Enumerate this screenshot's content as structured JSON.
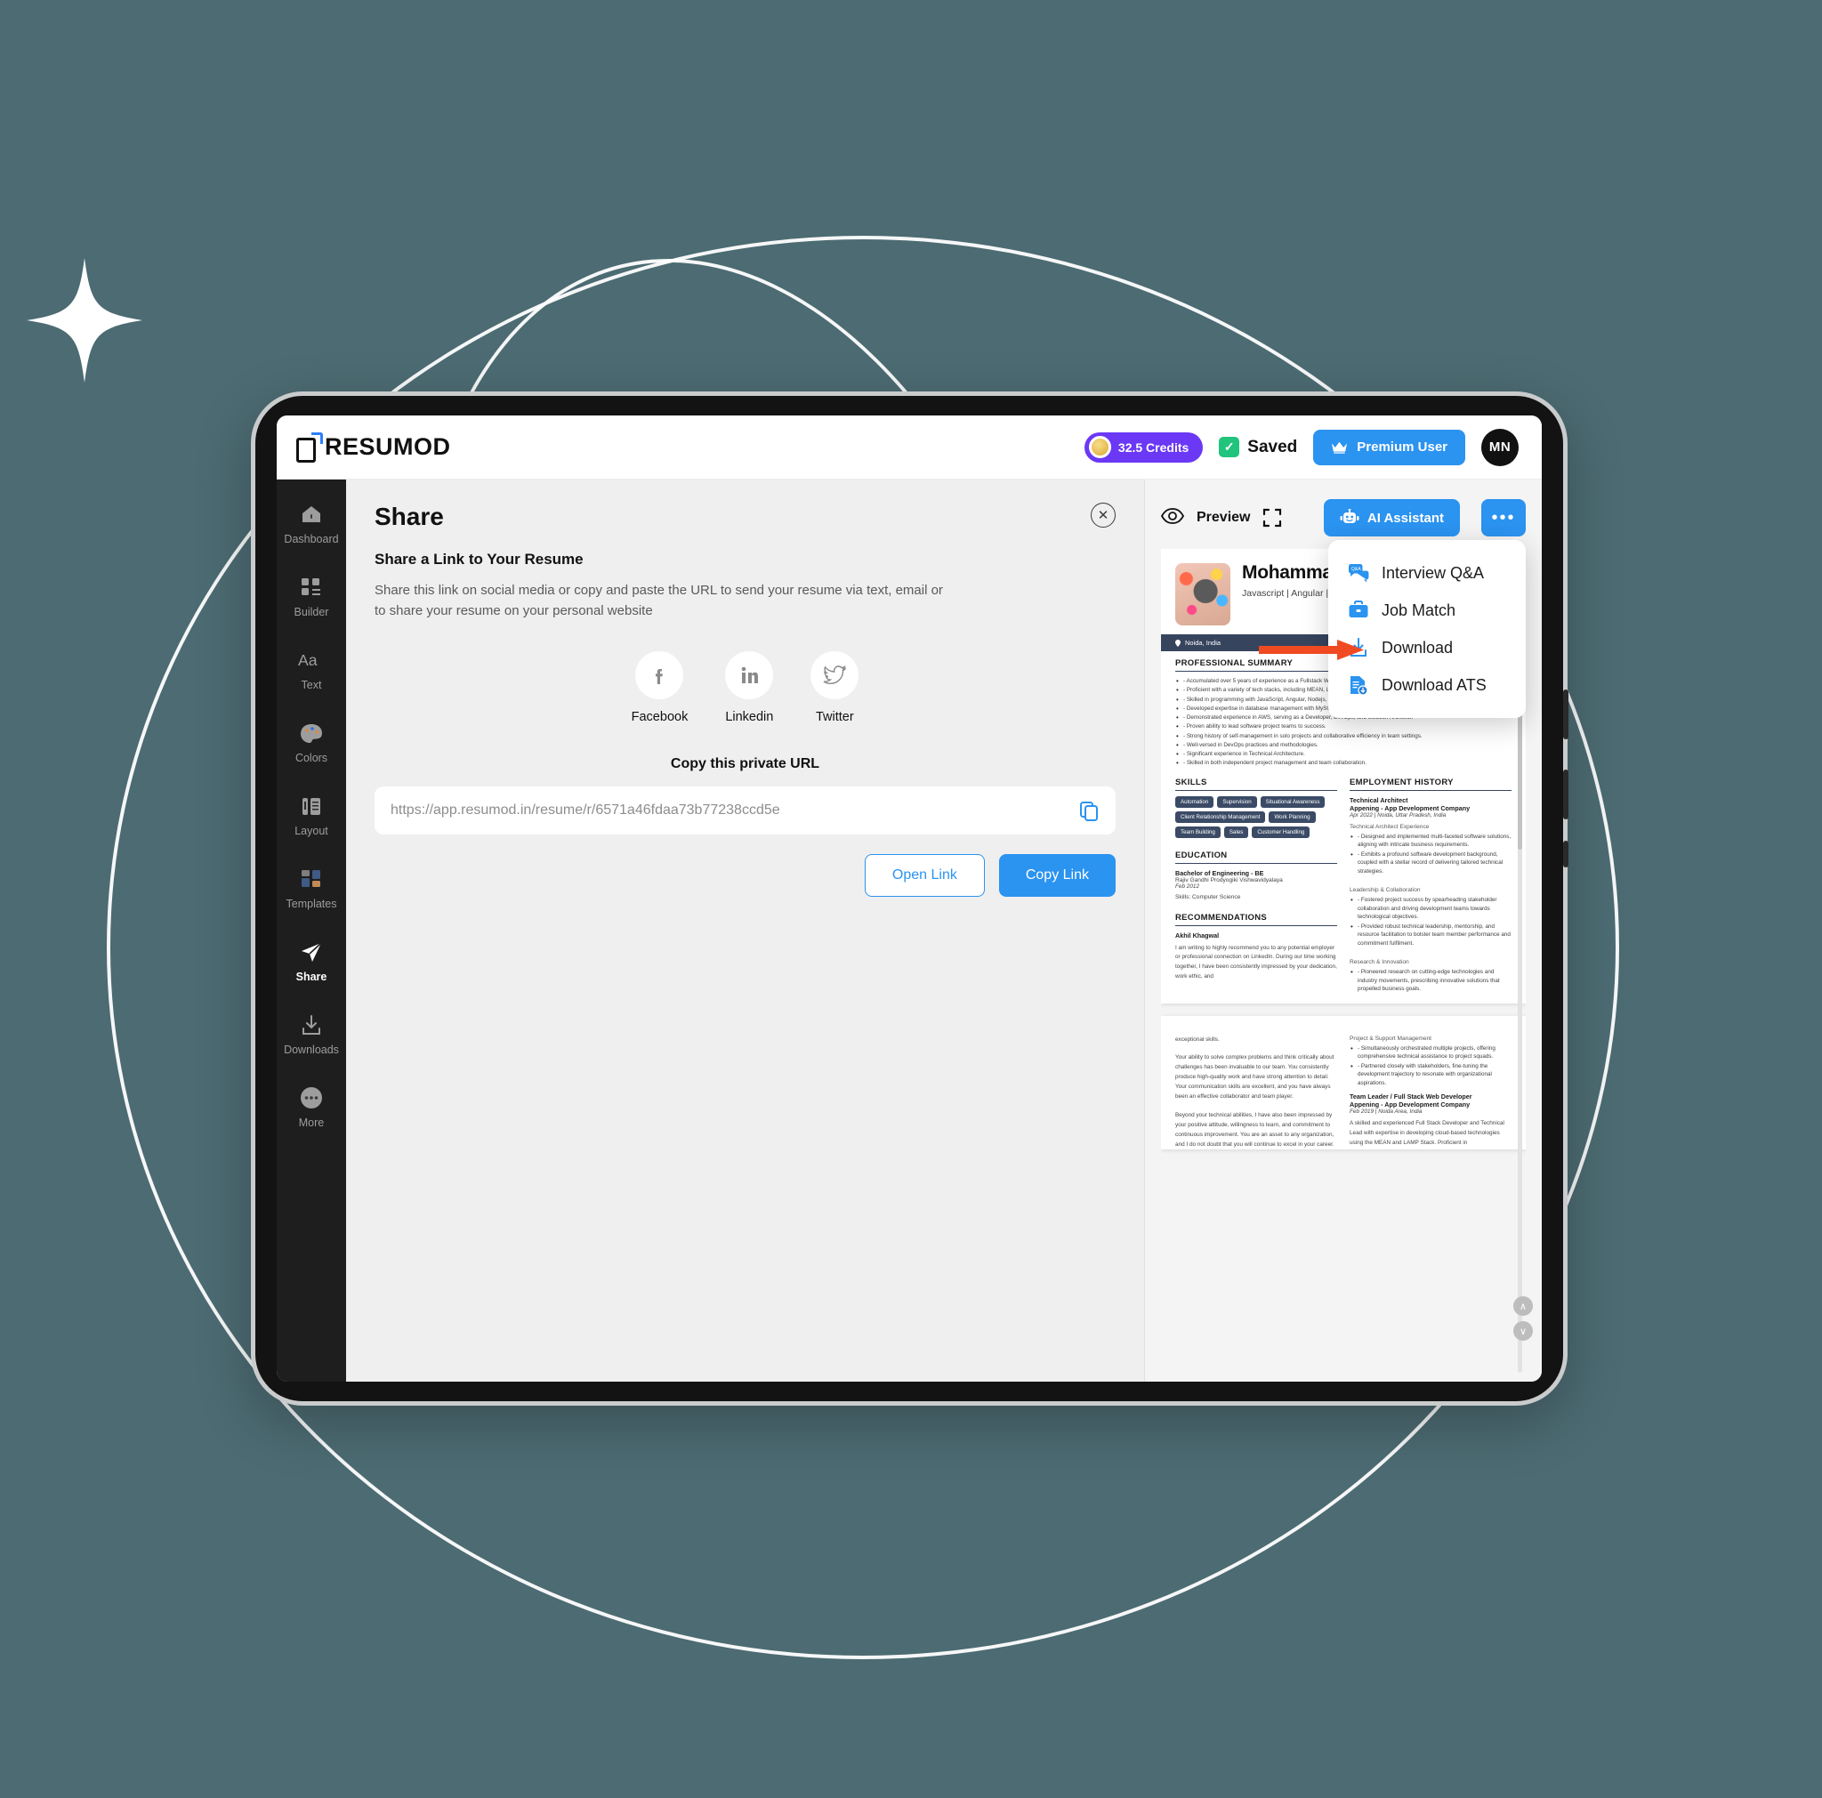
{
  "app": {
    "logo_text": "RESUMOD"
  },
  "topbar": {
    "credits": "32.5 Credits",
    "saved_label": "Saved",
    "saved_check": "✓",
    "premium_label": "Premium User",
    "avatar_initials": "MN"
  },
  "sidebar": {
    "items": [
      {
        "label": "Dashboard",
        "icon": "home-icon",
        "active": false
      },
      {
        "label": "Builder",
        "icon": "builder-icon",
        "active": false
      },
      {
        "label": "Text",
        "icon": "text-icon",
        "active": false
      },
      {
        "label": "Colors",
        "icon": "palette-icon",
        "active": false
      },
      {
        "label": "Layout",
        "icon": "layout-icon",
        "active": false
      },
      {
        "label": "Templates",
        "icon": "templates-icon",
        "active": false
      },
      {
        "label": "Share",
        "icon": "share-icon",
        "active": true
      },
      {
        "label": "Downloads",
        "icon": "download-icon",
        "active": false
      },
      {
        "label": "More",
        "icon": "more-icon",
        "active": false
      }
    ]
  },
  "share": {
    "title": "Share",
    "close_label": "✕",
    "subtitle": "Share a Link to Your Resume",
    "description": "Share this link on social media or copy and paste the URL to send your resume via text, email or to share your resume on your personal website",
    "socials": [
      {
        "label": "Facebook",
        "icon": "facebook-icon"
      },
      {
        "label": "Linkedin",
        "icon": "linkedin-icon"
      },
      {
        "label": "Twitter",
        "icon": "twitter-icon"
      }
    ],
    "copy_heading": "Copy this private URL",
    "url_value": "https://app.resumod.in/resume/r/6571a46fdaa73b77238ccd5e",
    "open_link_label": "Open Link",
    "copy_link_label": "Copy Link"
  },
  "preview": {
    "label": "Preview",
    "ai_assistant_label": "AI Assistant",
    "more_label": "•••",
    "menu": [
      {
        "label": "Interview Q&A",
        "icon": "chat-qa-icon"
      },
      {
        "label": "Job Match",
        "icon": "briefcase-icon"
      },
      {
        "label": "Download",
        "icon": "download-arrow-icon"
      },
      {
        "label": "Download ATS",
        "icon": "document-download-icon"
      }
    ],
    "scroll_up": "∧",
    "scroll_down": "∨"
  },
  "resume": {
    "name": "Mohammad Rizwan",
    "tagline": "Javascript | Angular | MySQL | AWS",
    "location": "Noida, India",
    "summary_title": "PROFESSIONAL SUMMARY",
    "summary_bullets": [
      "- Accumulated over 5 years of experience as a Fullstack Web Developer.",
      "- Proficient with a variety of tech stacks, including MEAN, LAMP",
      "- Skilled in programming with JavaScript, Angular, Nodejs, React",
      "- Developed expertise in database management with MySQL and MongoDB.",
      "- Demonstrated experience in AWS, serving as a Developer, DevOps, and Solution Architect.",
      "- Proven ability to lead software project teams to success.",
      "- Strong history of self-management in solo projects and collaborative efficiency in team settings.",
      "- Well-versed in DevOps practices and methodologies.",
      "- Significant experience in Technical Architecture.",
      "- Skilled in both independent project management and team collaboration."
    ],
    "skills_title": "SKILLS",
    "skills": [
      "Automation",
      "Supervision",
      "Situational Awareness",
      "Client Relationship Management",
      "Work Planning",
      "Team Building",
      "Sales",
      "Customer Handling"
    ],
    "education_title": "EDUCATION",
    "education": {
      "degree": "Bachelor of Engineering - BE",
      "school": "Rajiv Gandhi Prodyogiki Vishwavidyalaya",
      "date": "Feb 2012",
      "extra": "Skills: Computer Science"
    },
    "recommendations_title": "RECOMMENDATIONS",
    "recommendation": {
      "author": "Akhil Khagwal",
      "text": "I am writing to highly recommend you to any potential employer or professional connection on LinkedIn. During our time working together, I have been consistently impressed by your dedication, work ethic, and"
    },
    "employment_title": "EMPLOYMENT HISTORY",
    "jobs": [
      {
        "role": "Technical Architect",
        "company": "Appening - App Development Company",
        "meta": "Apr 2022 | Noida, Uttar Pradesh, India",
        "groups": [
          {
            "heading": "Technical Architect Experience",
            "bullets": [
              "- Designed and implemented multi-faceted software solutions, aligning with intricate business requirements.",
              "- Exhibits a profound software development background, coupled with a stellar record of delivering tailored technical strategies."
            ]
          },
          {
            "heading": "Leadership & Collaboration",
            "bullets": [
              "- Fostered project success by spearheading stakeholder collaboration and driving development teams towards technological objectives.",
              "- Provided robust technical leadership, mentorship, and resource facilitation to bolster team member performance and commitment fulfilment."
            ]
          },
          {
            "heading": "Research & Innovation",
            "bullets": [
              "- Pioneered research on cutting-edge technologies and industry movements, prescribing innovative solutions that propelled business goals."
            ]
          }
        ]
      }
    ],
    "page2": {
      "left_first_line": "exceptional skills.",
      "left_paragraphs": [
        "Your ability to solve complex problems and think critically about challenges has been invaluable to our team. You consistently produce high-quality work and have strong attention to detail. Your communication skills are excellent, and you have always been an effective collaborator and team player.",
        "Beyond your technical abilities, I have also been impressed by your positive attitude, willingness to learn, and commitment to continuous improvement. You are an asset to any organization, and I do not doubt that you will continue to excel in your career."
      ],
      "right_group_heading": "Project & Support Management",
      "right_bullets": [
        "- Simultaneously orchestrated multiple projects, offering comprehensive technical assistance to project squads.",
        "- Partnered closely with stakeholders, fine-tuning the development trajectory to resonate with organizational aspirations."
      ],
      "right_job": {
        "role": "Team Leader / Full Stack Web Developer",
        "company": "Appening - App Development Company",
        "meta": "Feb 2019 | Noida Area, India",
        "text": "A skilled and experienced Full Stack Developer and Technical Lead with expertise in developing cloud-based technologies using the MEAN and LAMP Stack. Proficient in"
      }
    }
  },
  "colors": {
    "accent_blue": "#2b93f0",
    "credits_purple": "#6b38f5",
    "saved_green": "#21c47d",
    "sidebar_dark": "#1e1e1e",
    "resume_navy": "#36445e",
    "background_teal": "#4c6b72",
    "arrow_orange": "#f04a22"
  }
}
